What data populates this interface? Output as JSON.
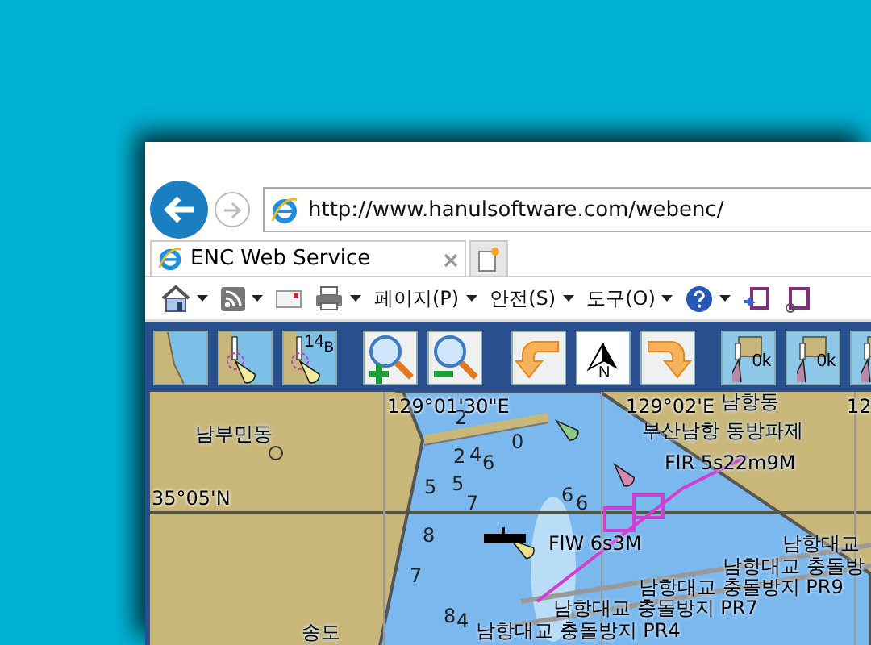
{
  "browser": {
    "url": "http://www.hanulsoftware.com/webenc/",
    "tab": {
      "title": "ENC Web Service",
      "selected": true
    },
    "commands": [
      {
        "kind": "home",
        "dropdown": true
      },
      {
        "kind": "feeds",
        "dropdown": true
      },
      {
        "kind": "mail",
        "dropdown": false
      },
      {
        "kind": "print",
        "dropdown": true
      },
      {
        "kind": "menu",
        "label": "페이지(P)",
        "dropdown": true
      },
      {
        "kind": "menu",
        "label": "안전(S)",
        "dropdown": true
      },
      {
        "kind": "menu",
        "label": "도구(O)",
        "dropdown": true
      },
      {
        "kind": "help",
        "dropdown": true
      },
      {
        "kind": "note",
        "dropdown": false
      },
      {
        "kind": "note-link",
        "dropdown": false
      }
    ]
  },
  "toolbar": [
    {
      "kind": "land"
    },
    {
      "kind": "light"
    },
    {
      "kind": "light-number",
      "label": "14$_{B}$"
    },
    {
      "kind": "zoom-in"
    },
    {
      "kind": "zoom-out"
    },
    {
      "kind": "rotate-left"
    },
    {
      "kind": "north",
      "label": "N"
    },
    {
      "kind": "rotate-right"
    },
    {
      "kind": "scale",
      "label": "0k"
    },
    {
      "kind": "scale",
      "label": "0k"
    },
    {
      "kind": "scale"
    }
  ],
  "map": {
    "labels": [
      {
        "kind": "coordinate",
        "text": "129°01'30\"E"
      },
      {
        "kind": "coordinate",
        "text": "129°02'E"
      },
      {
        "kind": "place",
        "text": "남항동"
      },
      {
        "kind": "coordinate",
        "text": "12"
      },
      {
        "kind": "place",
        "text": "남부민동"
      },
      {
        "kind": "place",
        "text": "부산남항 동방파제"
      },
      {
        "kind": "light",
        "text": "FlR 5s22m9M"
      },
      {
        "kind": "coordinate",
        "text": "35°05'N"
      },
      {
        "kind": "light",
        "text": "FlW 6s3M"
      },
      {
        "kind": "place",
        "text": "남항대교"
      },
      {
        "kind": "place",
        "text": "남항대교 충돌방"
      },
      {
        "kind": "place",
        "text": "남항대교 충돌방지 PR9"
      },
      {
        "kind": "place",
        "text": "남항대교 충돌방지 PR7"
      },
      {
        "kind": "place",
        "text": "송도"
      },
      {
        "kind": "place",
        "text": "남항대교 충돌방지 PR4"
      }
    ],
    "soundings": [
      "2",
      "0",
      "2",
      "4",
      "6",
      "5",
      "5",
      "7",
      "6",
      "6",
      "8",
      "7",
      "8",
      "4"
    ]
  }
}
